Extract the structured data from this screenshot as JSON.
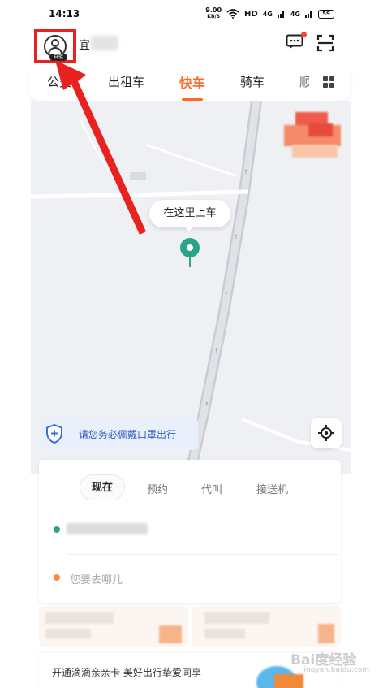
{
  "status_bar": {
    "time": "14:13",
    "speed_value": "9.00",
    "speed_unit": "KB/S",
    "hd_label": "HD",
    "network_1": "4G",
    "network_2": "4G",
    "battery": "59"
  },
  "header": {
    "city": "宜",
    "avatar_badge": "自驱",
    "icons": [
      "message-icon",
      "scan-icon"
    ]
  },
  "tabs": {
    "items": [
      {
        "label": "公交"
      },
      {
        "label": "出租车"
      },
      {
        "label": "快车"
      },
      {
        "label": "骑车"
      },
      {
        "label": "顺"
      }
    ],
    "active": "快车"
  },
  "map": {
    "pickup_tip": "在这里上车"
  },
  "notice": {
    "mask_text": "请您务必佩戴口罩出行"
  },
  "booking": {
    "modes": [
      {
        "label": "现在"
      },
      {
        "label": "预约"
      },
      {
        "label": "代叫"
      },
      {
        "label": "接送机"
      }
    ],
    "active_mode": "现在",
    "destination_placeholder": "您要去哪儿"
  },
  "bottom_card": {
    "text": "开通滴滴亲亲卡 美好出行挚爱同享"
  },
  "watermark": {
    "text": "Bai度经验",
    "sub": "jingyan.baidu.com"
  },
  "colors": {
    "accent": "#ff6a2a",
    "pin_green": "#2aa389",
    "annotation_red": "#e8231f",
    "notice_blue": "#2f5fc0"
  }
}
